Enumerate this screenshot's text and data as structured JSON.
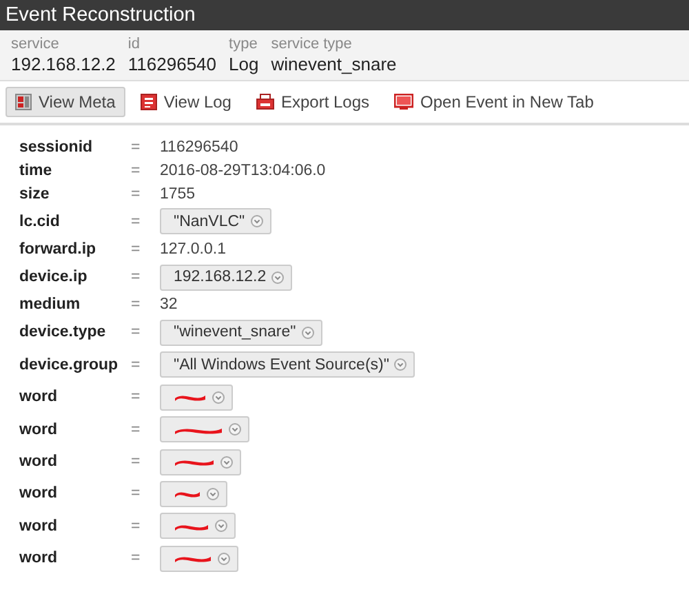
{
  "window": {
    "title": "Event Reconstruction"
  },
  "summary": [
    {
      "label": "service",
      "value": "192.168.12.2"
    },
    {
      "label": "id",
      "value": "116296540"
    },
    {
      "label": "type",
      "value": "Log"
    },
    {
      "label": "service type",
      "value": "winevent_snare"
    }
  ],
  "toolbar": [
    {
      "label": "View Meta",
      "kind": "meta",
      "selected": true
    },
    {
      "label": "View Log",
      "kind": "log",
      "selected": false
    },
    {
      "label": "Export Logs",
      "kind": "export",
      "selected": false
    },
    {
      "label": "Open Event in New Tab",
      "kind": "newtab",
      "selected": false
    }
  ],
  "meta": [
    {
      "key": "sessionid",
      "operator": "=",
      "value": "116296540",
      "kind": "plain"
    },
    {
      "key": "time",
      "operator": "=",
      "value": "2016-08-29T13:04:06.0",
      "kind": "plain"
    },
    {
      "key": "size",
      "operator": "=",
      "value": "1755",
      "kind": "plain"
    },
    {
      "key": "lc.cid",
      "operator": "=",
      "value": "\"NanVLC\"",
      "kind": "menu"
    },
    {
      "key": "forward.ip",
      "operator": "=",
      "value": "127.0.0.1",
      "kind": "plain"
    },
    {
      "key": "device.ip",
      "operator": "=",
      "value": "192.168.12.2",
      "kind": "menu"
    },
    {
      "key": "medium",
      "operator": "=",
      "value": "32",
      "kind": "plain"
    },
    {
      "key": "device.type",
      "operator": "=",
      "value": "\"winevent_snare\"",
      "kind": "menu"
    },
    {
      "key": "device.group",
      "operator": "=",
      "value": "\"All Windows Event Source(s)\"",
      "kind": "menu"
    },
    {
      "key": "word",
      "operator": "=",
      "kind": "redacted"
    },
    {
      "key": "word",
      "operator": "=",
      "kind": "redacted"
    },
    {
      "key": "word",
      "operator": "=",
      "kind": "redacted"
    },
    {
      "key": "word",
      "operator": "=",
      "kind": "redacted"
    },
    {
      "key": "word",
      "operator": "=",
      "kind": "redacted"
    },
    {
      "key": "word",
      "operator": "=",
      "kind": "redacted"
    }
  ]
}
